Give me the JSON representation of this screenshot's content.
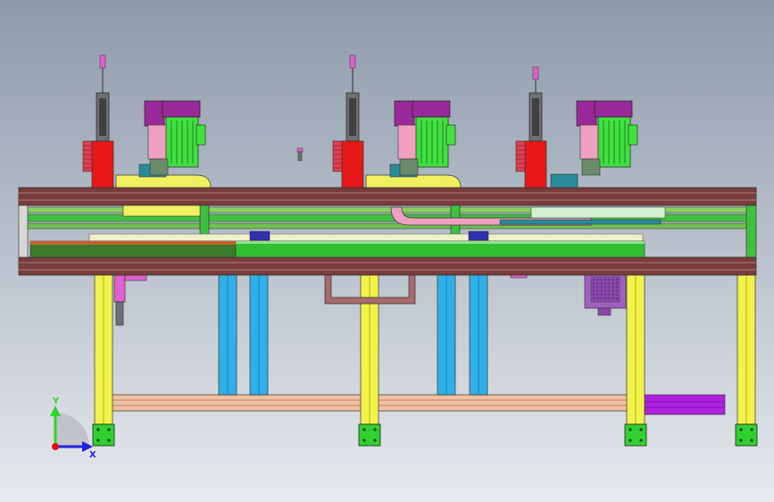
{
  "viewport": {
    "background_top": "#8e9aab",
    "background_bottom": "#e6e9ee"
  },
  "triad": {
    "y_label": "Y",
    "x_label": "X",
    "y_color": "#2bd62b",
    "x_color": "#2020e0",
    "z_color": "#e01010"
  },
  "colors": {
    "frame_brown": "#7a3c3c",
    "frame_brown_light": "#a86a6a",
    "leg_yellow": "#f2f24a",
    "foot_green": "#30d030",
    "column_blue": "#30b0e8",
    "crossbar_peach": "#f0c0a0",
    "rail_green": "#40c040",
    "plate_dark_green": "#3a7a2a",
    "plate_orange": "#c86030",
    "yellow_part": "#f0f060",
    "red_block": "#e81818",
    "motor_green": "#40e040",
    "gearbox_purple": "#9a2a9a",
    "pink_part": "#f0a0c0",
    "cylinder_gray": "#707070",
    "teal_part": "#2a8a9a",
    "violet_box": "#a060c0",
    "purple_bar": "#b020e0",
    "navy_block": "#3030b0"
  }
}
